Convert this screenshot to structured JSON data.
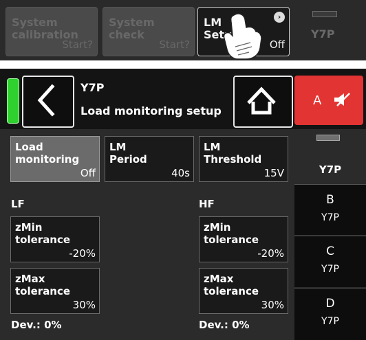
{
  "top_strip": {
    "buttons": [
      {
        "line1": "System",
        "line2": "calibration",
        "value": "Start?"
      },
      {
        "line1": "System",
        "line2": "check",
        "value": "Start?"
      },
      {
        "line1": "LM",
        "line2": "Setup",
        "value": "Off"
      }
    ],
    "channel_label": "Y7P"
  },
  "header": {
    "device": "Y7P",
    "title": "Load monitoring setup",
    "mute_label": "A",
    "colors": {
      "status_led": "#2fd12f",
      "mute": "#e23433"
    }
  },
  "params": {
    "load_monitoring": {
      "line1": "Load",
      "line2": "monitoring",
      "value": "Off"
    },
    "lm_period": {
      "line1": "LM",
      "line2": "Period",
      "value": "40s"
    },
    "lm_threshold": {
      "line1": "LM",
      "line2": "Threshold",
      "value": "15V"
    }
  },
  "lf": {
    "label": "LF",
    "zmin": {
      "line1": "zMin",
      "line2": "tolerance",
      "value": "-20%"
    },
    "zmax": {
      "line1": "zMax",
      "line2": "tolerance",
      "value": "30%"
    },
    "dev": "Dev.: 0%"
  },
  "hf": {
    "label": "HF",
    "zmin": {
      "line1": "zMin",
      "line2": "tolerance",
      "value": "-20%"
    },
    "zmax": {
      "line1": "zMax",
      "line2": "tolerance",
      "value": "30%"
    },
    "dev": "Dev.: 0%"
  },
  "channels": [
    {
      "name": "",
      "sub": "Y7P"
    },
    {
      "name": "B",
      "sub": "Y7P"
    },
    {
      "name": "C",
      "sub": "Y7P"
    },
    {
      "name": "D",
      "sub": "Y7P"
    }
  ]
}
